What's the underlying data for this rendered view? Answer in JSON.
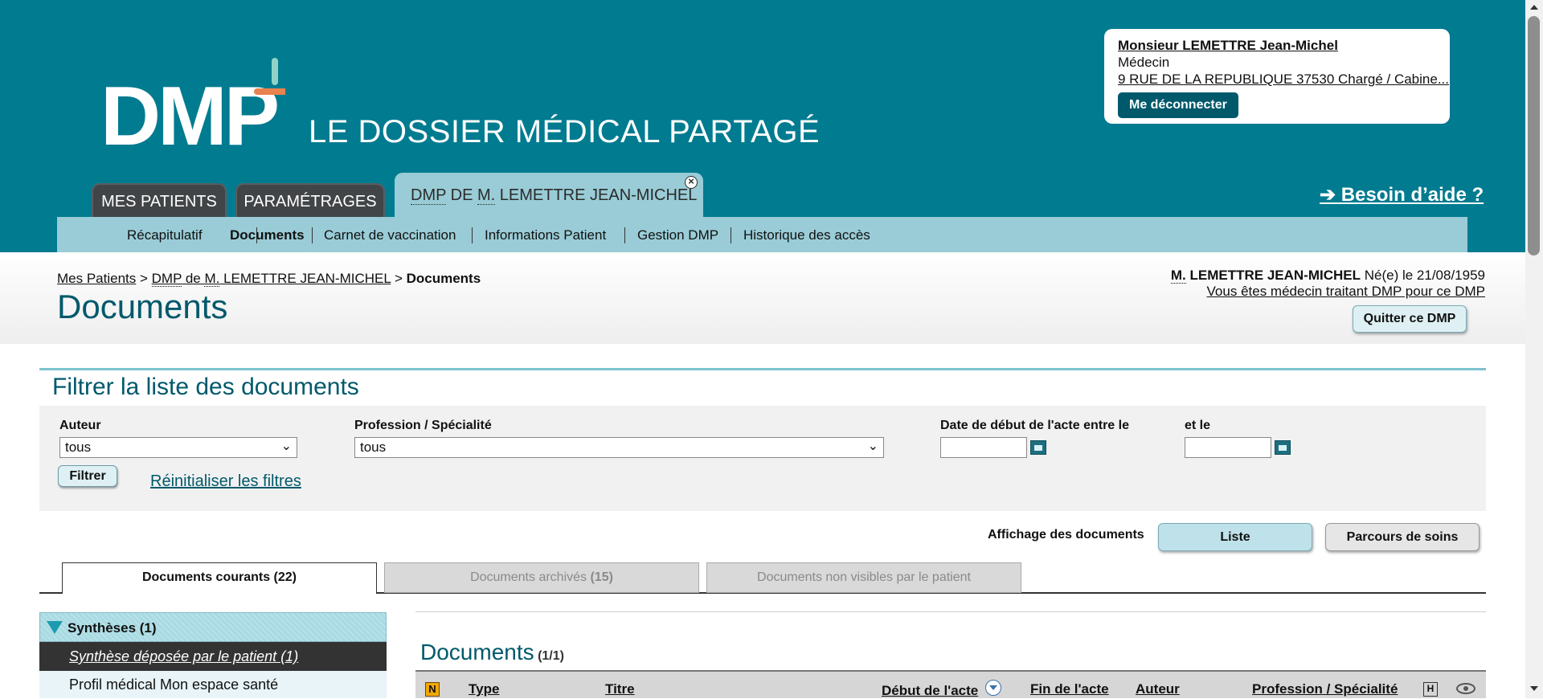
{
  "header": {
    "logo_text": "DMP",
    "subtitle": "LE DOSSIER MÉDICAL PARTAGÉ",
    "help_link": "➔ Besoin d’aide ?",
    "colors": {
      "header_bg": "#007b90",
      "subnav_bg": "#99ccd6",
      "accent_orange": "#e8824f"
    }
  },
  "user_card": {
    "name": "Monsieur LEMETTRE Jean-Michel",
    "role": "Médecin",
    "address": "9 RUE DE LA REPUBLIQUE 37530 Chargé / Cabine...",
    "logout_label": "Me déconnecter"
  },
  "main_tabs": {
    "mes_patients": "MES PATIENTS",
    "parametrages": "PARAMÉTRAGES",
    "dmp_abbr": "DMP",
    "dmp_de": " DE ",
    "dmp_m": "M.",
    "dmp_name": " LEMETTRE JEAN-MICHEL",
    "close_symbol": "×"
  },
  "subnav": {
    "recapitulatif": "Récapitulatif",
    "documents": "Documents",
    "carnet": "Carnet de vaccination",
    "informations": "Informations Patient",
    "gestion": "Gestion DMP",
    "historique": "Historique des accès"
  },
  "breadcrumb": {
    "mes_patients": "Mes Patients",
    "sep1": " > ",
    "dmp_prefix": "DMP",
    "dmp_de": " de ",
    "dmp_m": "M.",
    "dmp_name": " LEMETTRE JEAN-MICHEL",
    "sep2": " > ",
    "current": "Documents"
  },
  "page_title": "Documents",
  "patient": {
    "title_abbr": "M.",
    "name": " LEMETTRE JEAN-MICHEL",
    "born_label": " Né(e) le  21/08/1959",
    "treating": "Vous êtes médecin traitant DMP pour ce DMP",
    "quit_label": "Quitter ce DMP"
  },
  "filter": {
    "title": "Filtrer la liste des documents",
    "author_label": "Auteur",
    "author_value": "tous",
    "profession_label": "Profession / Spécialité",
    "profession_value": "tous",
    "date_from_label": "Date de début de l'acte entre le",
    "date_to_label": "et le",
    "date_from_value": "",
    "date_to_value": "",
    "filter_button": "Filtrer",
    "reset_link": "Réinitialiser les filtres"
  },
  "view": {
    "label": "Affichage des documents",
    "liste": "Liste",
    "parcours": "Parcours de soins",
    "selected": "Liste"
  },
  "doc_tabs": {
    "courants": "Documents courants (22)",
    "archives_text": "Documents archivés ",
    "archives_count": "(15)",
    "nonvisibles": "Documents non visibles par le patient"
  },
  "left_panel": {
    "syntheses": "Synthèses (1)",
    "synthese_item": "Synthèse déposée par le patient (1)",
    "profil_item": "Profil médical Mon espace santé"
  },
  "documents": {
    "title": "Documents",
    "count": " (1/1)",
    "columns": {
      "new_badge": "N",
      "type": "Type",
      "titre": "Titre",
      "debut": "Début de l'acte",
      "fin": "Fin de l'acte",
      "auteur": "Auteur",
      "profession": "Profession / Spécialité",
      "h_badge": "H"
    }
  }
}
